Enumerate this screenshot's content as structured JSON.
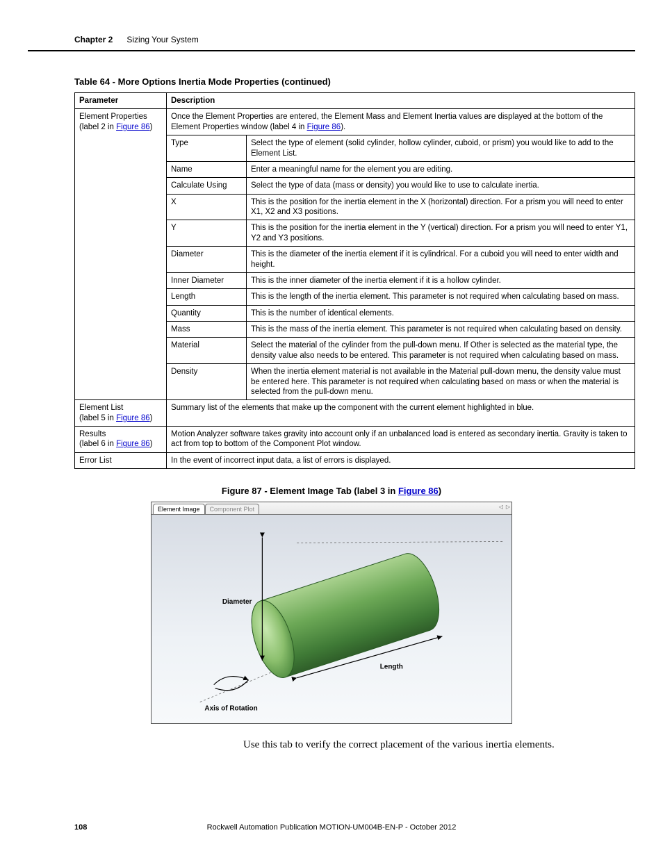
{
  "header": {
    "chapter_label": "Chapter 2",
    "chapter_title": "Sizing Your System"
  },
  "table": {
    "caption": "Table 64 - More Options Inertia Mode Properties (continued)",
    "head_param": "Parameter",
    "head_desc": "Description",
    "elem_props_intro_a": "Once the Element Properties are entered, the Element Mass and Element Inertia values are displayed at the bottom of the Element Properties window (label 4 in ",
    "elem_props_intro_link": "Figure 86",
    "elem_props_intro_b": ").",
    "param_elem_props_a": "Element Properties",
    "param_elem_props_b": "(label 2 in ",
    "param_elem_props_link": "Figure 86",
    "param_elem_props_c": ")",
    "rows": [
      {
        "sub": "Type",
        "desc": "Select the type of element (solid cylinder, hollow cylinder, cuboid, or prism) you would like to add to the Element List."
      },
      {
        "sub": "Name",
        "desc": "Enter a meaningful name for the element you are editing."
      },
      {
        "sub": "Calculate Using",
        "desc": "Select the type of data (mass or density) you would like to use to calculate inertia."
      },
      {
        "sub": "X",
        "desc": "This is the position for the inertia element in the X (horizontal) direction. For a prism you will need to enter X1, X2 and X3 positions."
      },
      {
        "sub": "Y",
        "desc": "This is the position for the inertia element in the Y (vertical) direction. For a prism you will need to enter Y1, Y2 and Y3 positions."
      },
      {
        "sub": "Diameter",
        "desc": "This is the diameter of the inertia element if it is cylindrical. For a cuboid you will need to enter width and height."
      },
      {
        "sub": "Inner Diameter",
        "desc": "This is the inner diameter of the inertia element if it is a hollow cylinder."
      },
      {
        "sub": "Length",
        "desc": "This is the length of the inertia element. This parameter is not required when calculating based on mass."
      },
      {
        "sub": "Quantity",
        "desc": "This is the number of identical elements."
      },
      {
        "sub": "Mass",
        "desc": "This is the mass of the inertia element. This parameter is not required when calculating based on density."
      },
      {
        "sub": "Material",
        "desc": "Select the material of the cylinder from the pull-down menu. If Other is selected as the material type, the density value also needs to be entered. This parameter is not required when calculating based on mass."
      },
      {
        "sub": "Density",
        "desc": "When the inertia element material is not available in the Material pull-down menu, the density value must be entered here. This parameter is not required when calculating based on mass or when the material is selected from the pull-down menu."
      }
    ],
    "param_elem_list_a": "Element List",
    "param_elem_list_b": "(label 5 in ",
    "param_elem_list_link": "Figure 86",
    "param_elem_list_c": ")",
    "desc_elem_list": "Summary list of the elements that make up the component with the current element highlighted in blue.",
    "param_results_a": "Results",
    "param_results_b": "(label 6 in ",
    "param_results_link": "Figure 86",
    "param_results_c": ")",
    "desc_results": "Motion Analyzer software takes gravity into account only if an unbalanced load is entered as secondary inertia. Gravity is taken to act from top to bottom of the Component Plot window.",
    "param_error": "Error List",
    "desc_error": "In the event of incorrect input data, a list of errors is displayed."
  },
  "figure": {
    "caption_a": "Figure 87 - Element Image Tab (label 3 in ",
    "caption_link": "Figure 86",
    "caption_b": ")",
    "tab_active": "Element Image",
    "tab_inactive": "Component Plot",
    "nav_prev": "◁",
    "nav_next": "▷",
    "label_diameter": "Diameter",
    "label_length": "Length",
    "label_axis": "Axis of Rotation"
  },
  "body_text": "Use this tab to verify the correct placement of the various inertia elements.",
  "footer": {
    "page": "108",
    "pub": "Rockwell Automation Publication MOTION-UM004B-EN-P - October 2012"
  }
}
